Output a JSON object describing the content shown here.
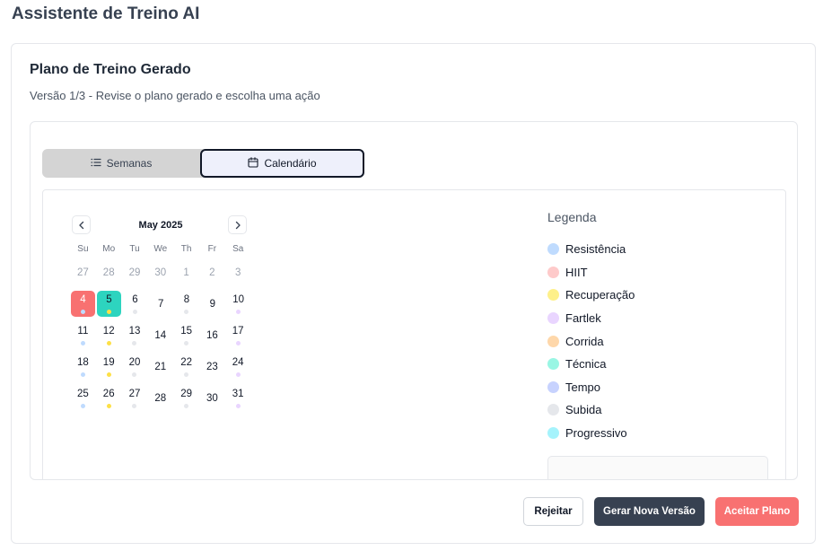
{
  "app": {
    "title": "Assistente de Treino AI"
  },
  "plan": {
    "title": "Plano de Treino Gerado",
    "subtitle": "Versão 1/3 - Revise o plano gerado e escolha uma ação"
  },
  "tabs": [
    {
      "label": "Semanas",
      "icon": "list-icon",
      "active": false
    },
    {
      "label": "Calendário",
      "icon": "calendar-icon",
      "active": true
    }
  ],
  "calendar": {
    "month": "May 2025",
    "weekdays": [
      "Su",
      "Mo",
      "Tu",
      "We",
      "Th",
      "Fr",
      "Sa"
    ],
    "weeks": [
      [
        {
          "d": "27",
          "out": true,
          "c": null
        },
        {
          "d": "28",
          "out": true,
          "c": null
        },
        {
          "d": "29",
          "out": true,
          "c": null
        },
        {
          "d": "30",
          "out": true,
          "c": null
        },
        {
          "d": "1",
          "out": true,
          "c": null
        },
        {
          "d": "2",
          "out": true,
          "c": null
        },
        {
          "d": "3",
          "out": true,
          "c": null
        }
      ],
      [
        {
          "d": "4",
          "c": "#bfdbfe",
          "sel": "red"
        },
        {
          "d": "5",
          "c": "#fde047",
          "sel": "teal"
        },
        {
          "d": "6",
          "c": "#e5e7eb"
        },
        {
          "d": "7",
          "c": null
        },
        {
          "d": "8",
          "c": "#e5e7eb"
        },
        {
          "d": "9",
          "c": null
        },
        {
          "d": "10",
          "c": "#e9d5ff"
        }
      ],
      [
        {
          "d": "11",
          "c": "#bfdbfe"
        },
        {
          "d": "12",
          "c": "#fde047"
        },
        {
          "d": "13",
          "c": "#e5e7eb"
        },
        {
          "d": "14",
          "c": null
        },
        {
          "d": "15",
          "c": "#e5e7eb"
        },
        {
          "d": "16",
          "c": null
        },
        {
          "d": "17",
          "c": "#e9d5ff"
        }
      ],
      [
        {
          "d": "18",
          "c": "#bfdbfe"
        },
        {
          "d": "19",
          "c": "#fde047"
        },
        {
          "d": "20",
          "c": "#e5e7eb"
        },
        {
          "d": "21",
          "c": null
        },
        {
          "d": "22",
          "c": "#e5e7eb"
        },
        {
          "d": "23",
          "c": null
        },
        {
          "d": "24",
          "c": "#e9d5ff"
        }
      ],
      [
        {
          "d": "25",
          "c": "#bfdbfe"
        },
        {
          "d": "26",
          "c": "#fde047"
        },
        {
          "d": "27",
          "c": "#e5e7eb"
        },
        {
          "d": "28",
          "c": null
        },
        {
          "d": "29",
          "c": "#e5e7eb"
        },
        {
          "d": "30",
          "c": null
        },
        {
          "d": "31",
          "c": "#e9d5ff"
        }
      ]
    ]
  },
  "legend": {
    "title": "Legenda",
    "items": [
      {
        "label": "Resistência",
        "color": "#bfdbfe"
      },
      {
        "label": "HIIT",
        "color": "#fecaca"
      },
      {
        "label": "Recuperação",
        "color": "#fef08a"
      },
      {
        "label": "Fartlek",
        "color": "#e9d5ff"
      },
      {
        "label": "Corrida",
        "color": "#fed7aa"
      },
      {
        "label": "Técnica",
        "color": "#99f6e4"
      },
      {
        "label": "Tempo",
        "color": "#c7d2fe"
      },
      {
        "label": "Subida",
        "color": "#e5e7eb"
      },
      {
        "label": "Progressivo",
        "color": "#a5f3fc"
      }
    ]
  },
  "actions": {
    "reject": "Rejeitar",
    "new_version": "Gerar Nova Versão",
    "accept": "Aceitar Plano"
  }
}
